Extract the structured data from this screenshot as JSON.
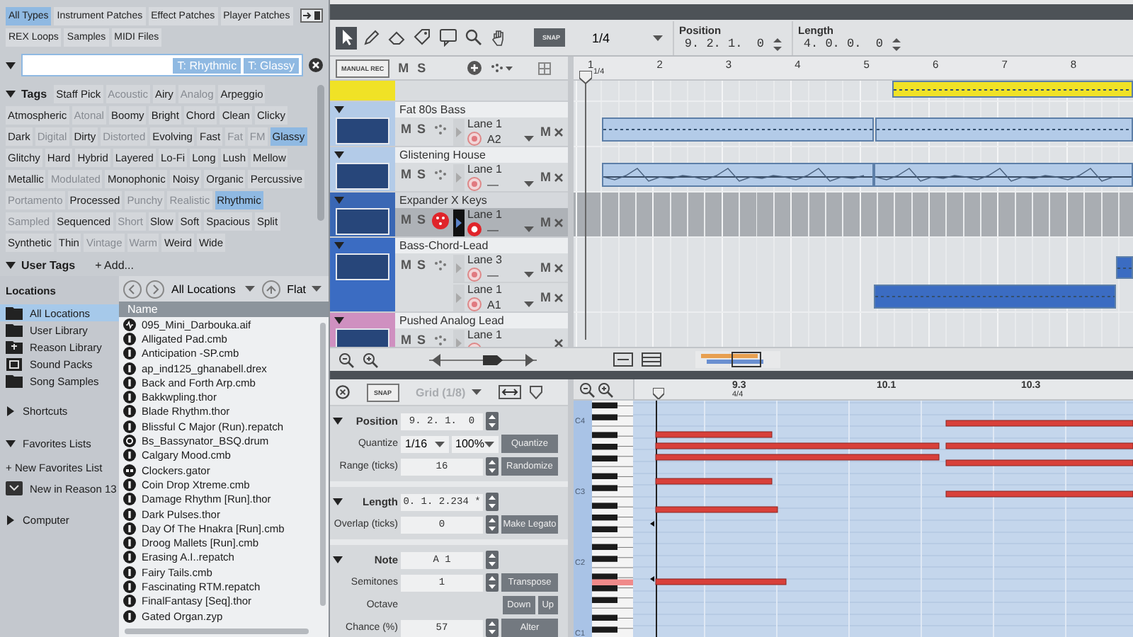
{
  "browser": {
    "type_tabs": [
      {
        "label": "All Types",
        "selected": true
      },
      {
        "label": "Instrument Patches",
        "selected": false
      },
      {
        "label": "Effect Patches",
        "selected": false
      },
      {
        "label": "Player Patches",
        "selected": false
      },
      {
        "label": "REX Loops",
        "selected": false
      },
      {
        "label": "Samples",
        "selected": false
      },
      {
        "label": "MIDI Files",
        "selected": false
      }
    ],
    "search": {
      "filters": [
        "T: Rhythmic",
        "T: Glassy"
      ]
    },
    "tags_heading": "Tags",
    "tags": [
      {
        "label": "Staff Pick",
        "selected": false,
        "disabled": false
      },
      {
        "label": "Acoustic",
        "selected": false,
        "disabled": true
      },
      {
        "label": "Airy",
        "selected": false,
        "disabled": false
      },
      {
        "label": "Analog",
        "selected": false,
        "disabled": true
      },
      {
        "label": "Arpeggio",
        "selected": false,
        "disabled": false
      },
      {
        "label": "Atmospheric",
        "selected": false,
        "disabled": false
      },
      {
        "label": "Atonal",
        "selected": false,
        "disabled": true
      },
      {
        "label": "Boomy",
        "selected": false,
        "disabled": false
      },
      {
        "label": "Bright",
        "selected": false,
        "disabled": false
      },
      {
        "label": "Chord",
        "selected": false,
        "disabled": false
      },
      {
        "label": "Clean",
        "selected": false,
        "disabled": false
      },
      {
        "label": "Clicky",
        "selected": false,
        "disabled": false
      },
      {
        "label": "Dark",
        "selected": false,
        "disabled": false
      },
      {
        "label": "Digital",
        "selected": false,
        "disabled": true
      },
      {
        "label": "Dirty",
        "selected": false,
        "disabled": false
      },
      {
        "label": "Distorted",
        "selected": false,
        "disabled": true
      },
      {
        "label": "Evolving",
        "selected": false,
        "disabled": false
      },
      {
        "label": "Fast",
        "selected": false,
        "disabled": false
      },
      {
        "label": "Fat",
        "selected": false,
        "disabled": true
      },
      {
        "label": "FM",
        "selected": false,
        "disabled": true
      },
      {
        "label": "Glassy",
        "selected": true,
        "disabled": false
      },
      {
        "label": "Glitchy",
        "selected": false,
        "disabled": false
      },
      {
        "label": "Hard",
        "selected": false,
        "disabled": false
      },
      {
        "label": "Hybrid",
        "selected": false,
        "disabled": false
      },
      {
        "label": "Layered",
        "selected": false,
        "disabled": false
      },
      {
        "label": "Lo-Fi",
        "selected": false,
        "disabled": false
      },
      {
        "label": "Long",
        "selected": false,
        "disabled": false
      },
      {
        "label": "Lush",
        "selected": false,
        "disabled": false
      },
      {
        "label": "Mellow",
        "selected": false,
        "disabled": false
      },
      {
        "label": "Metallic",
        "selected": false,
        "disabled": false
      },
      {
        "label": "Modulated",
        "selected": false,
        "disabled": true
      },
      {
        "label": "Monophonic",
        "selected": false,
        "disabled": false
      },
      {
        "label": "Noisy",
        "selected": false,
        "disabled": false
      },
      {
        "label": "Organic",
        "selected": false,
        "disabled": false
      },
      {
        "label": "Percussive",
        "selected": false,
        "disabled": false
      },
      {
        "label": "Portamento",
        "selected": false,
        "disabled": true
      },
      {
        "label": "Processed",
        "selected": false,
        "disabled": false
      },
      {
        "label": "Punchy",
        "selected": false,
        "disabled": true
      },
      {
        "label": "Realistic",
        "selected": false,
        "disabled": true
      },
      {
        "label": "Rhythmic",
        "selected": true,
        "disabled": false
      },
      {
        "label": "Sampled",
        "selected": false,
        "disabled": true
      },
      {
        "label": "Sequenced",
        "selected": false,
        "disabled": false
      },
      {
        "label": "Short",
        "selected": false,
        "disabled": true
      },
      {
        "label": "Slow",
        "selected": false,
        "disabled": false
      },
      {
        "label": "Soft",
        "selected": false,
        "disabled": false
      },
      {
        "label": "Spacious",
        "selected": false,
        "disabled": false
      },
      {
        "label": "Split",
        "selected": false,
        "disabled": false
      },
      {
        "label": "Synthetic",
        "selected": false,
        "disabled": false
      },
      {
        "label": "Thin",
        "selected": false,
        "disabled": false
      },
      {
        "label": "Vintage",
        "selected": false,
        "disabled": true
      },
      {
        "label": "Warm",
        "selected": false,
        "disabled": true
      },
      {
        "label": "Weird",
        "selected": false,
        "disabled": false
      },
      {
        "label": "Wide",
        "selected": false,
        "disabled": false
      }
    ],
    "user_tags": {
      "label": "User Tags",
      "add": "+ Add...",
      "expanded": true
    },
    "locations": {
      "title": "Locations",
      "items": [
        {
          "label": "All Locations",
          "selected": true,
          "kind": "folder"
        },
        {
          "label": "User Library",
          "selected": false,
          "kind": "folder"
        },
        {
          "label": "Reason Library",
          "selected": false,
          "kind": "library"
        },
        {
          "label": "Sound Packs",
          "selected": false,
          "kind": "pack"
        },
        {
          "label": "Song Samples",
          "selected": false,
          "kind": "folder"
        }
      ]
    },
    "shortcuts": {
      "label": "Shortcuts",
      "expanded": false
    },
    "favorites": {
      "label": "Favorites Lists",
      "expanded": true,
      "new": "+ New Favorites List",
      "items": [
        "New in Reason 13"
      ]
    },
    "computer": {
      "label": "Computer",
      "expanded": false
    },
    "nav": {
      "location": "All Locations",
      "view": "Flat"
    },
    "files": {
      "column": "Name",
      "items": [
        {
          "name": "095_Mini_Darbouka.aif",
          "kind": "audio"
        },
        {
          "name": "Alligated Pad.cmb",
          "kind": "instrument"
        },
        {
          "name": "Anticipation  -SP.cmb",
          "kind": "instrument"
        },
        {
          "name": "ap_ind125_ghanabell.drex",
          "kind": "instrument"
        },
        {
          "name": "Back and Forth Arp.cmb",
          "kind": "instrument"
        },
        {
          "name": "Bakkwpling.thor",
          "kind": "instrument"
        },
        {
          "name": "Blade Rhythm.thor",
          "kind": "instrument"
        },
        {
          "name": "Blissful C Major (Run).repatch",
          "kind": "instrument"
        },
        {
          "name": "Bs_Bassynator_BSQ.drum",
          "kind": "drum"
        },
        {
          "name": "Calgary Mood.cmb",
          "kind": "instrument"
        },
        {
          "name": "Clockers.gator",
          "kind": "effect"
        },
        {
          "name": "Coin Drop Xtreme.cmb",
          "kind": "instrument"
        },
        {
          "name": "Damage Rhythm [Run].thor",
          "kind": "instrument"
        },
        {
          "name": "Dark Pulses.thor",
          "kind": "instrument"
        },
        {
          "name": "Day Of The Hnakra [Run].cmb",
          "kind": "instrument"
        },
        {
          "name": "Droog Mallets [Run].cmb",
          "kind": "instrument"
        },
        {
          "name": "Erasing A.I..repatch",
          "kind": "instrument"
        },
        {
          "name": "Fairy Tails.cmb",
          "kind": "instrument"
        },
        {
          "name": "Fascinating RTM.repatch",
          "kind": "instrument"
        },
        {
          "name": "FinalFantasy [Seq].thor",
          "kind": "instrument"
        },
        {
          "name": "Gated Organ.zyp",
          "kind": "instrument"
        }
      ]
    }
  },
  "toolbar": {
    "tools": [
      {
        "kind": "pointer",
        "selected": true
      },
      {
        "kind": "pencil",
        "selected": false
      },
      {
        "kind": "eraser",
        "selected": false
      },
      {
        "kind": "tag",
        "selected": false
      },
      {
        "kind": "speech",
        "selected": false
      },
      {
        "kind": "magnifier",
        "selected": false
      },
      {
        "kind": "hand",
        "selected": false
      }
    ],
    "snap": "SNAP",
    "grid": "1/4",
    "position": {
      "label": "Position",
      "value": "9. 2. 1.  0"
    },
    "length": {
      "label": "Length",
      "value": "4. 0. 0.  0"
    }
  },
  "track_header": {
    "manual_rec": "MANUAL REC",
    "mute": "M",
    "solo": "S"
  },
  "ruler": {
    "bars": [
      "1",
      "2",
      "3",
      "4",
      "5",
      "6",
      "7",
      "8"
    ],
    "signature": "1/4"
  },
  "tracks": [
    {
      "color": "#f0e226",
      "selected": false
    },
    {
      "name": "Fat 80s Bass",
      "color": "#b3cbe8",
      "selected": false,
      "record_enabled": false,
      "mute": "M",
      "solo": "S",
      "lanes": [
        {
          "label": "Lane 1",
          "note": "A2",
          "armed": false,
          "mute": "M"
        }
      ]
    },
    {
      "name": "Glistening House",
      "color": "#b3cbe8",
      "selected": false,
      "record_enabled": false,
      "mute": "M",
      "solo": "S",
      "lanes": [
        {
          "label": "Lane 1",
          "note": "—",
          "armed": false,
          "mute": "M"
        }
      ]
    },
    {
      "name": "Expander X Keys",
      "color": "#3a67b4",
      "selected": true,
      "record_enabled": true,
      "mute": "M",
      "solo": "S",
      "lanes": [
        {
          "label": "Lane 1",
          "note": "—",
          "armed": true,
          "mute": "M"
        }
      ]
    },
    {
      "name": "Bass-Chord-Lead",
      "color": "#3b6cc2",
      "selected": false,
      "record_enabled": false,
      "mute": "M",
      "solo": "S",
      "lanes": [
        {
          "label": "Lane 3",
          "note": "—",
          "armed": false,
          "mute": "M"
        },
        {
          "label": "Lane 1",
          "note": "A1",
          "armed": false,
          "mute": "M"
        }
      ]
    },
    {
      "name": "Pushed Analog Lead",
      "color": "#cf90c0",
      "selected": false,
      "record_enabled": false,
      "mute": "M",
      "solo": "S",
      "lanes": [
        {
          "label": "Lane 1",
          "armed": false
        }
      ]
    }
  ],
  "inspector": {
    "snap": "SNAP",
    "grid": {
      "label": "Grid (1/8)",
      "disabled": true
    },
    "sections": [
      {
        "title": "Position",
        "value": "9. 2. 1.  0",
        "rows": [
          {
            "kind": "quantize",
            "label": "Quantize",
            "options": [
              "1/16",
              "100%"
            ],
            "button": "Quantize"
          },
          {
            "kind": "field",
            "label": "Range (ticks)",
            "value": "16",
            "button": "Randomize"
          }
        ]
      },
      {
        "title": "Length",
        "value": "0. 1. 2.234 *",
        "rows": [
          {
            "kind": "field",
            "label": "Overlap (ticks)",
            "value": "0",
            "button": "Make Legato"
          }
        ]
      },
      {
        "title": "Note",
        "value": "A 1",
        "rows": [
          {
            "kind": "field",
            "label": "Semitones",
            "value": "1",
            "button": "Transpose"
          },
          {
            "kind": "buttons",
            "label": "Octave",
            "buttons": [
              "Down",
              "Up"
            ]
          },
          {
            "kind": "field",
            "label": "Chance (%)",
            "value": "57",
            "button": "Alter"
          }
        ]
      }
    ]
  },
  "piano_roll": {
    "ruler": [
      {
        "label": "9.3",
        "signature": "4/4"
      },
      {
        "label": "10.1"
      },
      {
        "label": "10.3"
      }
    ],
    "keys": [
      "C4",
      "C3",
      "C2",
      "C1"
    ]
  }
}
